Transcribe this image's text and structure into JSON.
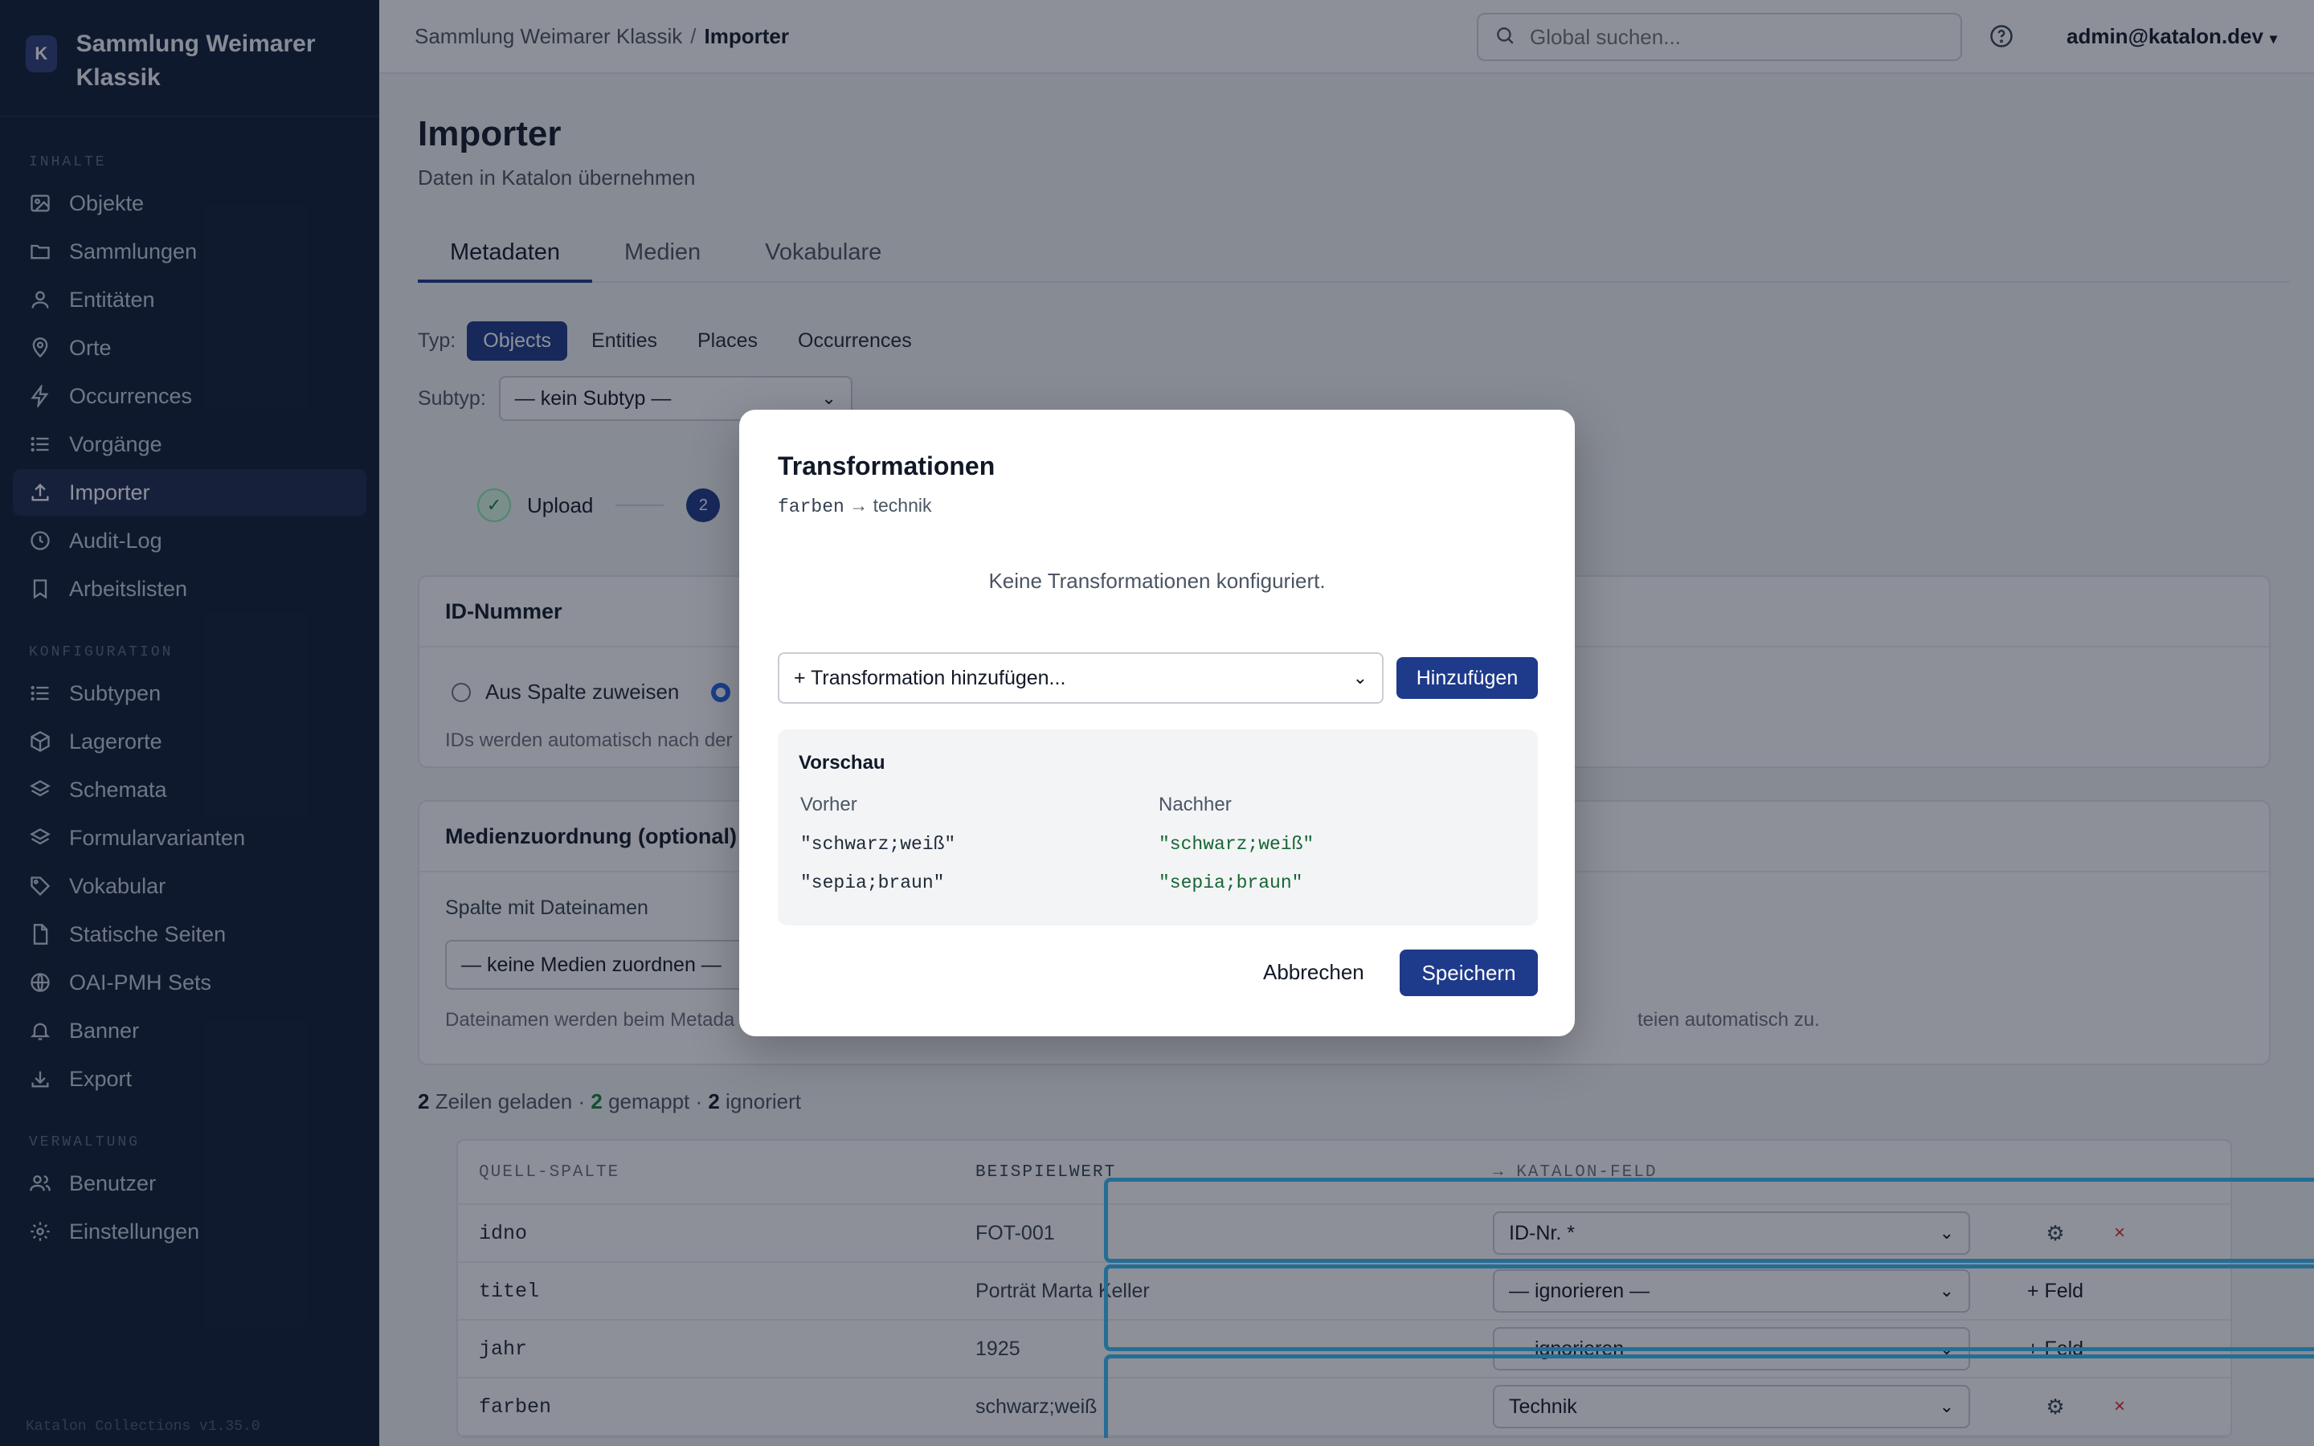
{
  "sidebar": {
    "logo_letter": "K",
    "brand": "Sammlung Weimarer Klassik",
    "sections": {
      "content": "INHALTE",
      "config": "KONFIGURATION",
      "admin": "VERWALTUNG"
    },
    "content_items": [
      {
        "label": "Objekte",
        "icon": "image-icon"
      },
      {
        "label": "Sammlungen",
        "icon": "folder-icon"
      },
      {
        "label": "Entitäten",
        "icon": "user-icon"
      },
      {
        "label": "Orte",
        "icon": "map-pin-icon"
      },
      {
        "label": "Occurrences",
        "icon": "lightning-icon"
      },
      {
        "label": "Vorgänge",
        "icon": "list-icon"
      },
      {
        "label": "Importer",
        "icon": "upload-icon",
        "active": true
      },
      {
        "label": "Audit-Log",
        "icon": "clock-icon"
      },
      {
        "label": "Arbeitslisten",
        "icon": "bookmark-icon"
      }
    ],
    "config_items": [
      {
        "label": "Subtypen",
        "icon": "list-icon"
      },
      {
        "label": "Lagerorte",
        "icon": "box-icon"
      },
      {
        "label": "Schemata",
        "icon": "layers-icon"
      },
      {
        "label": "Formularvarianten",
        "icon": "layers-icon"
      },
      {
        "label": "Vokabular",
        "icon": "tag-icon"
      },
      {
        "label": "Statische Seiten",
        "icon": "file-icon"
      },
      {
        "label": "OAI-PMH Sets",
        "icon": "globe-icon"
      },
      {
        "label": "Banner",
        "icon": "bell-icon"
      },
      {
        "label": "Export",
        "icon": "download-icon"
      }
    ],
    "admin_items": [
      {
        "label": "Benutzer",
        "icon": "users-icon"
      },
      {
        "label": "Einstellungen",
        "icon": "gear-icon"
      }
    ],
    "version": "Katalon Collections v1.35.0"
  },
  "topbar": {
    "breadcrumb_parent": "Sammlung Weimarer Klassik",
    "breadcrumb_sep": "/",
    "breadcrumb_current": "Importer",
    "search_placeholder": "Global suchen...",
    "user": "admin@katalon.dev",
    "user_caret": "▾"
  },
  "page": {
    "title": "Importer",
    "subtitle": "Daten in Katalon übernehmen",
    "tabs": [
      "Metadaten",
      "Medien",
      "Vokabulare"
    ],
    "type_label": "Typ:",
    "types": [
      "Objects",
      "Entities",
      "Places",
      "Occurrences"
    ],
    "subtype_label": "Subtyp:",
    "subtype_value": "— kein Subtyp —",
    "steps": {
      "step1_label": "Upload",
      "step1_mark": "✓",
      "step2_num": "2"
    },
    "id_card": {
      "title": "ID-Nummer",
      "option_column": "Aus Spalte zuweisen",
      "hint": "IDs werden automatisch nach der"
    },
    "media_card": {
      "title": "Medienzuordnung (optional)",
      "column_label": "Spalte mit Dateinamen",
      "select_value": "— keine Medien zuordnen —",
      "hint_left": "Dateinamen werden beim Metada",
      "hint_right": "teien automatisch zu."
    },
    "stats": {
      "rows": "2",
      "rows_text": " Zeilen geladen · ",
      "mapped": "2",
      "mapped_text": " gemappt · ",
      "ignored": "2",
      "ignored_text": " ignoriert"
    }
  },
  "table": {
    "headers": [
      "QUELL-SPALTE",
      "BEISPIELWERT",
      "→ KATALON-FELD"
    ],
    "rows": [
      {
        "source": "idno",
        "sample": "FOT-001",
        "field": "ID-Nr. *",
        "action": "gear",
        "remove": "×"
      },
      {
        "source": "titel",
        "sample": "Porträt Marta Keller",
        "field": "— ignorieren —",
        "action": "+ Feld",
        "remove": ""
      },
      {
        "source": "jahr",
        "sample": "1925",
        "field": "— ignorieren —",
        "action": "+ Feld",
        "remove": ""
      },
      {
        "source": "farben",
        "sample": "schwarz;weiß",
        "field": "Technik",
        "action": "gear",
        "remove": "×"
      }
    ]
  },
  "modal": {
    "title": "Transformationen",
    "source_field": "farben",
    "arrow": "→",
    "target_field": "technik",
    "empty_text": "Keine Transformationen konfiguriert.",
    "add_select": "+ Transformation hinzufügen...",
    "add_button": "Hinzufügen",
    "preview": {
      "title": "Vorschau",
      "before_header": "Vorher",
      "after_header": "Nachher",
      "rows": [
        {
          "before": "\"schwarz;weiß\"",
          "after": "\"schwarz;weiß\""
        },
        {
          "before": "\"sepia;braun\"",
          "after": "\"sepia;braun\""
        }
      ]
    },
    "cancel": "Abbrechen",
    "save": "Speichern"
  },
  "colors": {
    "sidebar_bg": "#0f1b34",
    "accent": "#1e3a8a",
    "highlight": "#38bdf8",
    "success": "#15803d",
    "danger": "#dc2626"
  }
}
